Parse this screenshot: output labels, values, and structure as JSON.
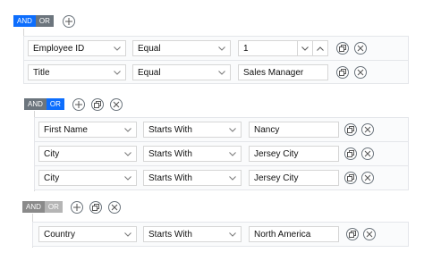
{
  "toggle": {
    "and": "AND",
    "or": "OR"
  },
  "group1": {
    "rules": [
      {
        "field": "Employee ID",
        "operator": "Equal",
        "value": "1"
      },
      {
        "field": "Title",
        "operator": "Equal",
        "value": "Sales Manager"
      }
    ]
  },
  "group2": {
    "rules": [
      {
        "field": "First Name",
        "operator": "Starts With",
        "value": "Nancy"
      },
      {
        "field": "City",
        "operator": "Starts With",
        "value": "Jersey City"
      },
      {
        "field": "City",
        "operator": "Starts With",
        "value": "Jersey City"
      }
    ]
  },
  "group3": {
    "rules": [
      {
        "field": "Country",
        "operator": "Starts With",
        "value": "North America"
      }
    ]
  },
  "colors": {
    "active": "#0d6efd",
    "inactive": "#6c757d"
  },
  "icons": [
    "add-icon",
    "clone-icon",
    "delete-icon",
    "chevron-down-icon",
    "chevron-up-icon"
  ]
}
